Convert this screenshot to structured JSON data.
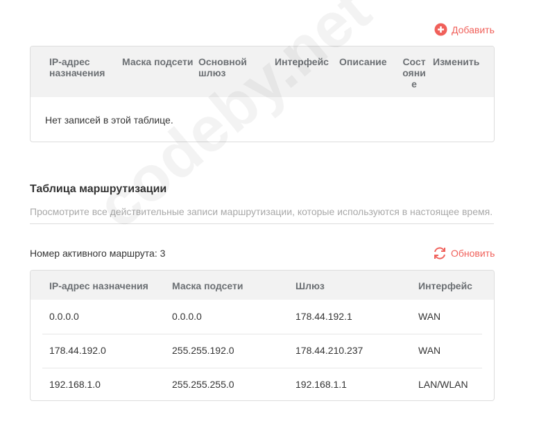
{
  "static_routes": {
    "add_label": "Добавить",
    "headers": [
      "IP-адрес назначения",
      "Маска подсети",
      "Основной шлюз",
      "Интерфейс",
      "Описание",
      "Состояние",
      "Изменить"
    ],
    "empty": "Нет записей в этой таблице."
  },
  "routing": {
    "title": "Таблица маршрутизации",
    "subtitle": "Просмотрите все действительные записи маршрутизации, которые используются в настоящее время.",
    "active_count": "Номер активного маршрута: 3",
    "refresh_label": "Обновить",
    "headers": [
      "IP-адрес назначения",
      "Маска подсети",
      "Шлюз",
      "Интерфейс"
    ],
    "rows": [
      [
        "0.0.0.0",
        "0.0.0.0",
        "178.44.192.1",
        "WAN"
      ],
      [
        "178.44.192.0",
        "255.255.192.0",
        "178.44.210.237",
        "WAN"
      ],
      [
        "192.168.1.0",
        "255.255.255.0",
        "192.168.1.1",
        "LAN/WLAN"
      ]
    ]
  },
  "watermark": "codeby.net",
  "colors": {
    "accent": "#f0605a"
  }
}
